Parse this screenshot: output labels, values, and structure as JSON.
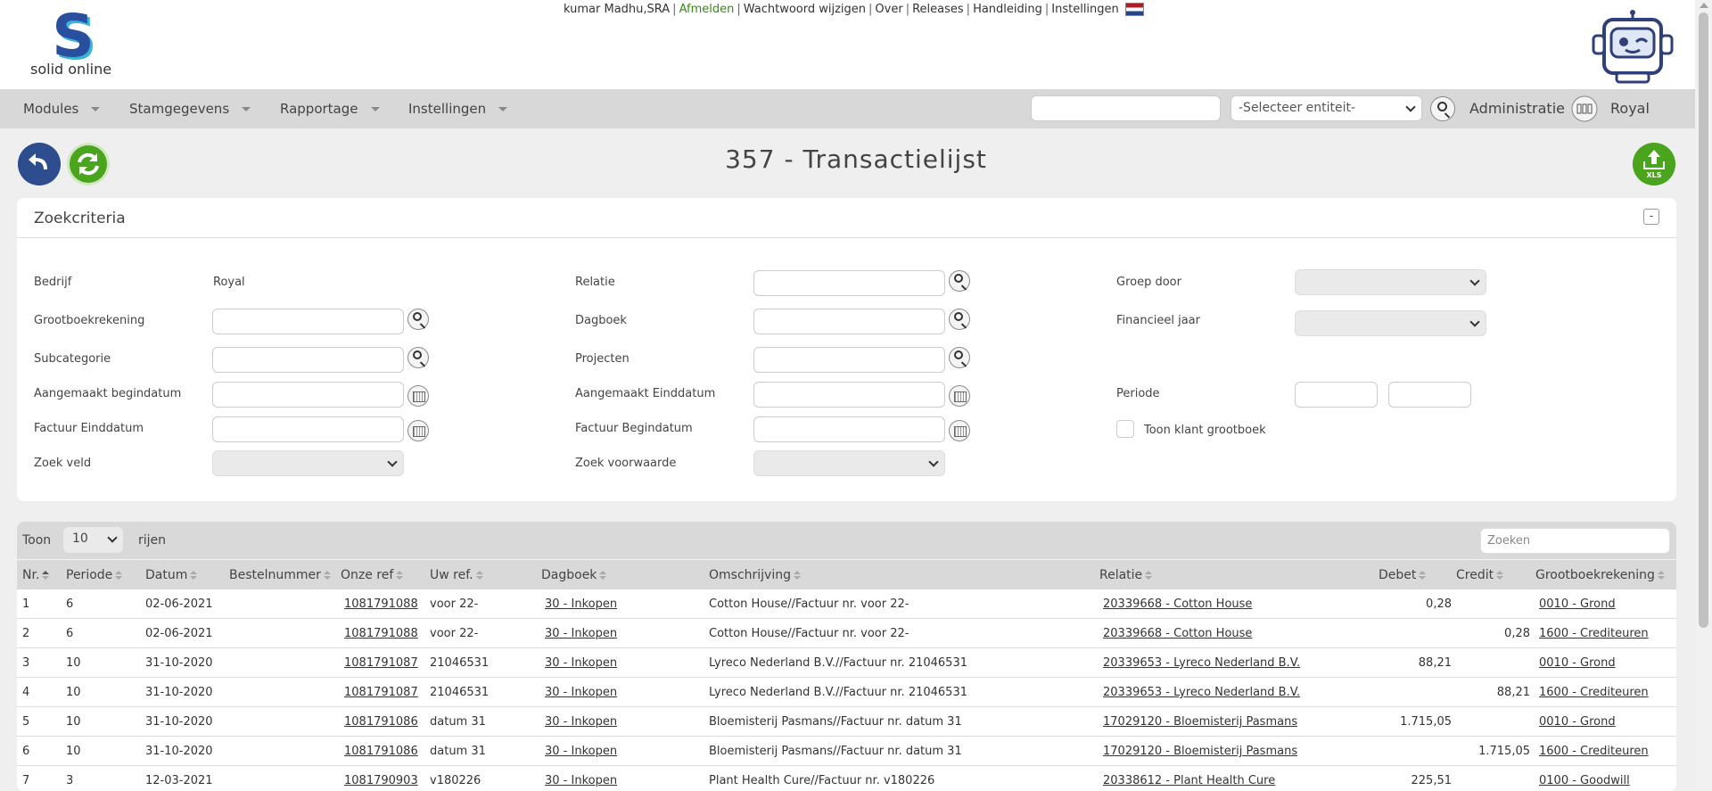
{
  "header": {
    "logo_text": "solid online",
    "user": "kumar Madhu,SRA",
    "links": [
      "Afmelden",
      "Wachtwoord wijzigen",
      "Over",
      "Releases",
      "Handleiding",
      "Instellingen"
    ]
  },
  "nav": {
    "items": [
      "Modules",
      "Stamgegevens",
      "Rapportage",
      "Instellingen"
    ],
    "entity_placeholder": "-Selecteer entiteit-",
    "administratie": "Administratie",
    "company": "Royal"
  },
  "page": {
    "title": "357 - Transactielijst"
  },
  "zoekcriteria": {
    "title": "Zoekcriteria",
    "collapse": "-",
    "bedrijf_label": "Bedrijf",
    "bedrijf_value": "Royal",
    "grootboek_label": "Grootboekrekening",
    "subcategorie_label": "Subcategorie",
    "aangemaakt_begin_label": "Aangemaakt begindatum",
    "factuur_eind_label": "Factuur Einddatum",
    "zoek_veld_label": "Zoek veld",
    "relatie_label": "Relatie",
    "dagboek_label": "Dagboek",
    "projecten_label": "Projecten",
    "aangemaakt_eind_label": "Aangemaakt Einddatum",
    "factuur_begin_label": "Factuur Begindatum",
    "zoek_voorwaarde_label": "Zoek voorwaarde",
    "groep_door_label": "Groep door",
    "financieel_jaar_label": "Financieel jaar",
    "periode_label": "Periode",
    "toon_klant_label": "Toon klant grootboek"
  },
  "table": {
    "toon": "Toon",
    "rows_value": "10",
    "rijen": "rijen",
    "search_placeholder": "Zoeken",
    "columns": [
      "Nr.",
      "Periode",
      "Datum",
      "Bestelnummer",
      "Onze ref",
      "Uw ref.",
      "Dagboek",
      "Omschrijving",
      "Relatie",
      "Debet",
      "Credit",
      "Grootboekrekening"
    ],
    "rows": [
      {
        "nr": "1",
        "periode": "6",
        "datum": "02-06-2021",
        "bestel": "",
        "onze_ref": "1081791088",
        "uw_ref": "voor 22-",
        "dagboek": "30 - Inkopen",
        "omschrijving": "Cotton House//Factuur nr. voor 22-",
        "relatie": "20339668 - Cotton House",
        "debet": "0,28",
        "credit": "",
        "grootboek": "0010 - Grond"
      },
      {
        "nr": "2",
        "periode": "6",
        "datum": "02-06-2021",
        "bestel": "",
        "onze_ref": "1081791088",
        "uw_ref": "voor 22-",
        "dagboek": "30 - Inkopen",
        "omschrijving": "Cotton House//Factuur nr. voor 22-",
        "relatie": "20339668 - Cotton House",
        "debet": "",
        "credit": "0,28",
        "grootboek": "1600 - Crediteuren"
      },
      {
        "nr": "3",
        "periode": "10",
        "datum": "31-10-2020",
        "bestel": "",
        "onze_ref": "1081791087",
        "uw_ref": "21046531",
        "dagboek": "30 - Inkopen",
        "omschrijving": "Lyreco Nederland B.V.//Factuur nr. 21046531",
        "relatie": "20339653 - Lyreco Nederland B.V.",
        "debet": "88,21",
        "credit": "",
        "grootboek": "0010 - Grond"
      },
      {
        "nr": "4",
        "periode": "10",
        "datum": "31-10-2020",
        "bestel": "",
        "onze_ref": "1081791087",
        "uw_ref": "21046531",
        "dagboek": "30 - Inkopen",
        "omschrijving": "Lyreco Nederland B.V.//Factuur nr. 21046531",
        "relatie": "20339653 - Lyreco Nederland B.V.",
        "debet": "",
        "credit": "88,21",
        "grootboek": "1600 - Crediteuren"
      },
      {
        "nr": "5",
        "periode": "10",
        "datum": "31-10-2020",
        "bestel": "",
        "onze_ref": "1081791086",
        "uw_ref": "datum 31",
        "dagboek": "30 - Inkopen",
        "omschrijving": "Bloemisterij Pasmans//Factuur nr. datum 31",
        "relatie": "17029120 - Bloemisterij Pasmans",
        "debet": "1.715,05",
        "credit": "",
        "grootboek": "0010 - Grond"
      },
      {
        "nr": "6",
        "periode": "10",
        "datum": "31-10-2020",
        "bestel": "",
        "onze_ref": "1081791086",
        "uw_ref": "datum 31",
        "dagboek": "30 - Inkopen",
        "omschrijving": "Bloemisterij Pasmans//Factuur nr. datum 31",
        "relatie": "17029120 - Bloemisterij Pasmans",
        "debet": "",
        "credit": "1.715,05",
        "grootboek": "1600 - Crediteuren"
      },
      {
        "nr": "7",
        "periode": "3",
        "datum": "12-03-2021",
        "bestel": "",
        "onze_ref": "1081790903",
        "uw_ref": "v180226",
        "dagboek": "30 - Inkopen",
        "omschrijving": "Plant Health Cure//Factuur nr. v180226",
        "relatie": "20338612 - Plant Health Cure",
        "debet": "225,51",
        "credit": "",
        "grootboek": "0100 - Goodwill"
      }
    ]
  },
  "icons": {
    "back": "back-arrow-icon",
    "refresh": "refresh-icon",
    "export": "export-xls-icon",
    "search": "search-icon",
    "calendar": "calendar-icon"
  },
  "colors": {
    "brand_blue": "#2e4d8f",
    "brand_green": "#4aa41e",
    "afmelden": "#3a8a14"
  }
}
